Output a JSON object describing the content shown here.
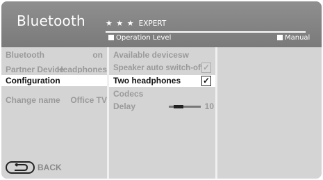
{
  "header": {
    "title": "Bluetooth",
    "stars": "★ ★ ★",
    "level": "EXPERT",
    "operation_label": "Operation Level",
    "manual_label": "Manual"
  },
  "left_menu": {
    "items": [
      {
        "label": "Bluetooth",
        "value": "on"
      },
      {
        "label": "Partner Device",
        "value": "Headphones"
      },
      {
        "label": "Configuration",
        "value": ""
      },
      {
        "label": "Change name",
        "value": "Office TV"
      }
    ],
    "selected_index": 2
  },
  "middle_menu": {
    "items": [
      {
        "label": "Available devicesw"
      },
      {
        "label": "Speaker auto switch-off",
        "checked": true,
        "check_glyph": "✓"
      },
      {
        "label": "Two headphones",
        "checked": true,
        "check_glyph": "✓"
      },
      {
        "label": "Codecs"
      },
      {
        "label": "Delay",
        "value": "10"
      }
    ],
    "selected_index": 2,
    "delay_level_fraction": 0.3
  },
  "footer": {
    "back_label": "BACK",
    "back_icon": "return-arrow-icon"
  },
  "colors": {
    "header_bg": "#858585",
    "panel_bg": "#d4d4d4",
    "selected_bg": "#ffffff",
    "disabled_text": "#9a9a9a",
    "selected_text": "#111111"
  }
}
